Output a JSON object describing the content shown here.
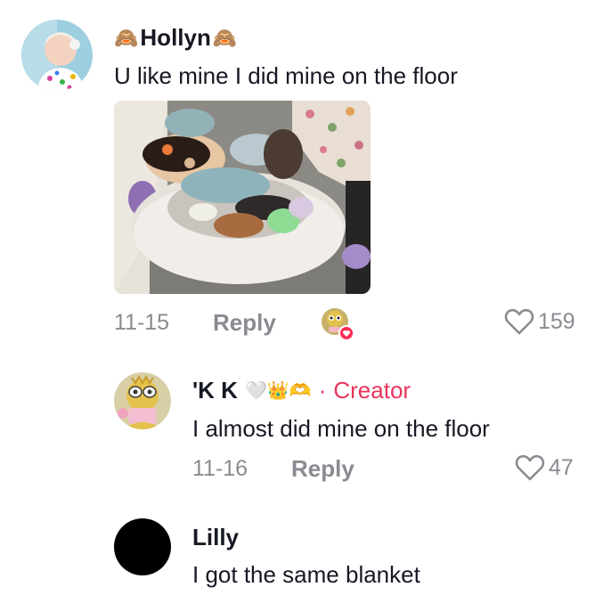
{
  "comment1": {
    "username": "Hollyn",
    "text": "U like mine I did mine on the floor",
    "date": "11-15",
    "reply_label": "Reply",
    "likes": "159",
    "emoji_left": "🙈",
    "emoji_right": "🙈"
  },
  "reply1": {
    "username": "'K K",
    "emojis": "🤍👑🫶",
    "creator_label": "Creator",
    "separator": "·",
    "text": "I almost did mine on the floor",
    "date": "11-16",
    "reply_label": "Reply",
    "likes": "47"
  },
  "comment2": {
    "username": "Lilly",
    "text": "I got the same blanket"
  },
  "colors": {
    "text": "#161823",
    "muted": "#8a8b91",
    "creator": "#e8345b",
    "like_badge": "#fe2c55"
  }
}
